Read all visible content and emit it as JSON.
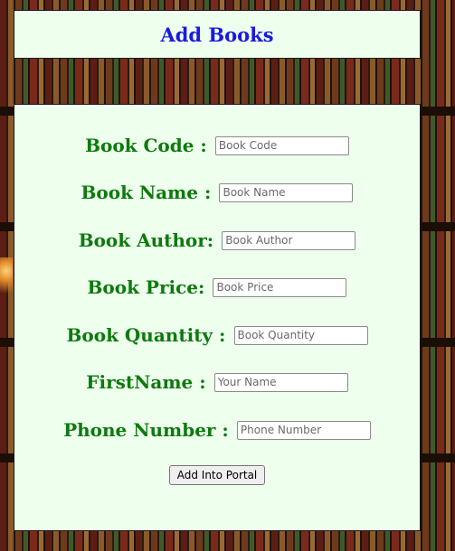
{
  "header": {
    "title": "Add Books"
  },
  "form": {
    "fields": [
      {
        "label": "Book Code :",
        "placeholder": "Book Code",
        "value": ""
      },
      {
        "label": "Book Name :",
        "placeholder": "Book Name",
        "value": ""
      },
      {
        "label": "Book Author:",
        "placeholder": "Book Author",
        "value": ""
      },
      {
        "label": "Book Price:",
        "placeholder": "Book Price",
        "value": ""
      },
      {
        "label": "Book Quantity :",
        "placeholder": "Book Quantity",
        "value": ""
      },
      {
        "label": "FirstName :",
        "placeholder": "Your Name",
        "value": ""
      },
      {
        "label": "Phone Number :",
        "placeholder": "Phone Number",
        "value": ""
      }
    ],
    "submit_label": "Add Into Portal"
  },
  "colors": {
    "panel_bg": "#eeffee",
    "title": "#1a1ae0",
    "label": "#0c7a0c"
  }
}
